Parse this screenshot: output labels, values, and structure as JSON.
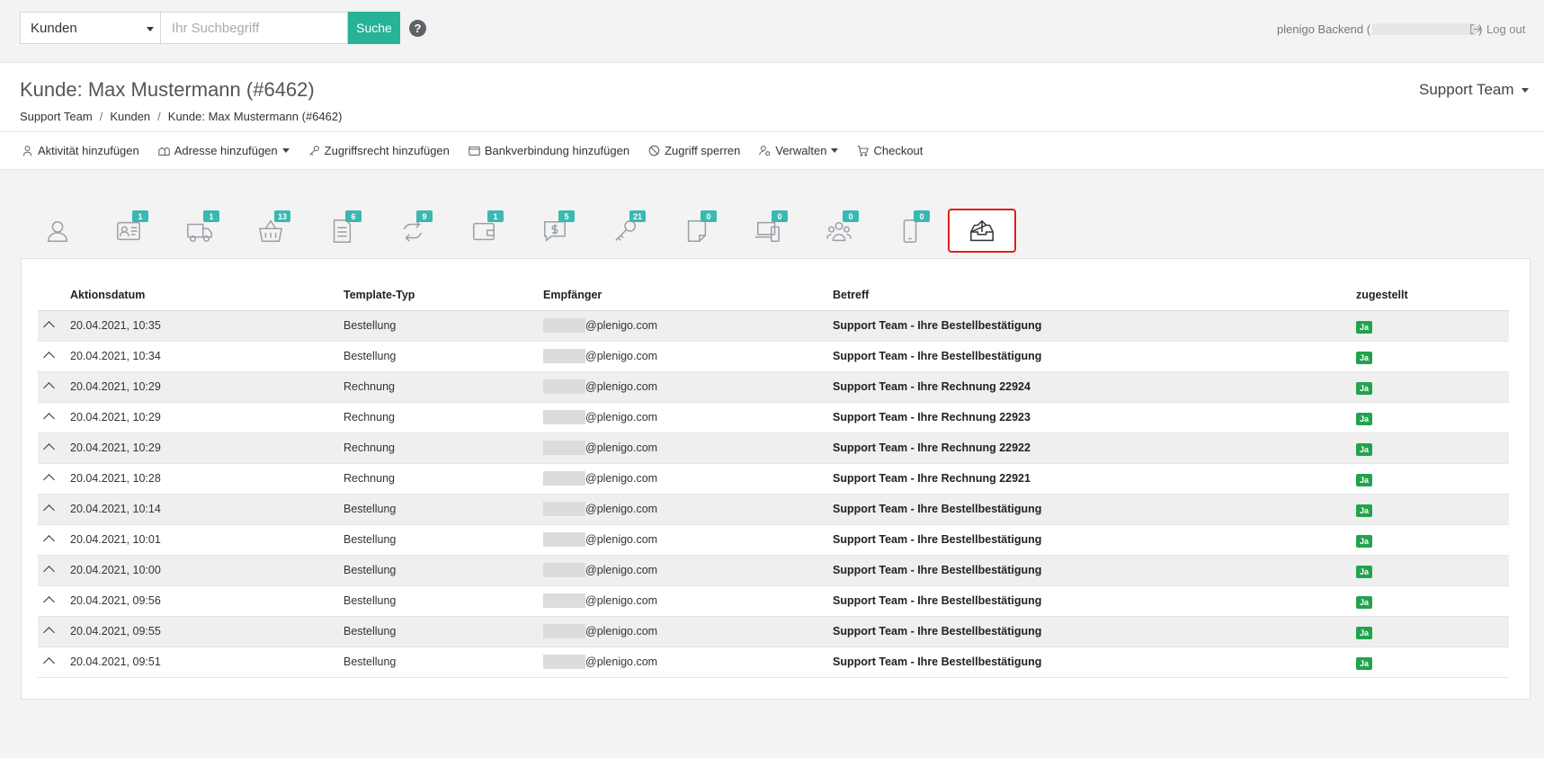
{
  "search": {
    "scope": "Kunden",
    "placeholder": "Ihr Suchbegriff",
    "button": "Suche",
    "help": "?"
  },
  "user": {
    "app_label": "plenigo Backend (",
    "close_paren": ")",
    "logout": "Log out"
  },
  "page": {
    "title": "Kunde: Max Mustermann (#6462)",
    "team": "Support Team"
  },
  "breadcrumb": [
    {
      "label": "Support Team"
    },
    {
      "label": "Kunden"
    },
    {
      "label": "Kunde: Max Mustermann (#6462)"
    }
  ],
  "breadcrumb_sep": "/",
  "toolbar": [
    {
      "label": "Aktivität hinzufügen",
      "icon": "activity-icon"
    },
    {
      "label": "Adresse hinzufügen",
      "icon": "address-icon",
      "dropdown": true
    },
    {
      "label": "Zugriffsrecht hinzufügen",
      "icon": "key-icon"
    },
    {
      "label": "Bankverbindung hinzufügen",
      "icon": "wallet-icon"
    },
    {
      "label": "Zugriff sperren",
      "icon": "block-icon"
    },
    {
      "label": "Verwalten",
      "icon": "manage-icon",
      "dropdown": true
    },
    {
      "label": "Checkout",
      "icon": "cart-icon"
    }
  ],
  "tabs": [
    {
      "icon": "user-icon",
      "badge": ""
    },
    {
      "icon": "id-card-icon",
      "badge": "1"
    },
    {
      "icon": "truck-icon",
      "badge": "1"
    },
    {
      "icon": "basket-icon",
      "badge": "13"
    },
    {
      "icon": "invoice-icon",
      "badge": "6"
    },
    {
      "icon": "repeat-icon",
      "badge": "9"
    },
    {
      "icon": "wallet-icon",
      "badge": "1"
    },
    {
      "icon": "message-dollar-icon",
      "badge": "5"
    },
    {
      "icon": "key-icon",
      "badge": "21"
    },
    {
      "icon": "note-icon",
      "badge": "0"
    },
    {
      "icon": "devices-icon",
      "badge": "0"
    },
    {
      "icon": "users-icon",
      "badge": "0"
    },
    {
      "icon": "mobile-icon",
      "badge": "0"
    },
    {
      "icon": "outbox-icon",
      "badge": ""
    }
  ],
  "table": {
    "headers": {
      "date": "Aktionsdatum",
      "type": "Template-Typ",
      "to": "Empfänger",
      "subject": "Betreff",
      "delivered": "zugestellt"
    },
    "email_domain": "@plenigo.com",
    "rows": [
      {
        "date": "20.04.2021, 10:35",
        "type": "Bestellung",
        "subject": "Support Team - Ihre Bestellbestätigung",
        "delivered": "Ja"
      },
      {
        "date": "20.04.2021, 10:34",
        "type": "Bestellung",
        "subject": "Support Team - Ihre Bestellbestätigung",
        "delivered": "Ja"
      },
      {
        "date": "20.04.2021, 10:29",
        "type": "Rechnung",
        "subject": "Support Team - Ihre Rechnung 22924",
        "delivered": "Ja"
      },
      {
        "date": "20.04.2021, 10:29",
        "type": "Rechnung",
        "subject": "Support Team - Ihre Rechnung 22923",
        "delivered": "Ja"
      },
      {
        "date": "20.04.2021, 10:29",
        "type": "Rechnung",
        "subject": "Support Team - Ihre Rechnung 22922",
        "delivered": "Ja"
      },
      {
        "date": "20.04.2021, 10:28",
        "type": "Rechnung",
        "subject": "Support Team - Ihre Rechnung 22921",
        "delivered": "Ja"
      },
      {
        "date": "20.04.2021, 10:14",
        "type": "Bestellung",
        "subject": "Support Team - Ihre Bestellbestätigung",
        "delivered": "Ja"
      },
      {
        "date": "20.04.2021, 10:01",
        "type": "Bestellung",
        "subject": "Support Team - Ihre Bestellbestätigung",
        "delivered": "Ja"
      },
      {
        "date": "20.04.2021, 10:00",
        "type": "Bestellung",
        "subject": "Support Team - Ihre Bestellbestätigung",
        "delivered": "Ja"
      },
      {
        "date": "20.04.2021, 09:56",
        "type": "Bestellung",
        "subject": "Support Team - Ihre Bestellbestätigung",
        "delivered": "Ja"
      },
      {
        "date": "20.04.2021, 09:55",
        "type": "Bestellung",
        "subject": "Support Team - Ihre Bestellbestätigung",
        "delivered": "Ja"
      },
      {
        "date": "20.04.2021, 09:51",
        "type": "Bestellung",
        "subject": "Support Team - Ihre Bestellbestätigung",
        "delivered": "Ja"
      }
    ]
  },
  "colors": {
    "accent": "#26b397",
    "badge": "#3ab8b2",
    "success": "#23a24d",
    "highlight": "#e01e1e"
  }
}
